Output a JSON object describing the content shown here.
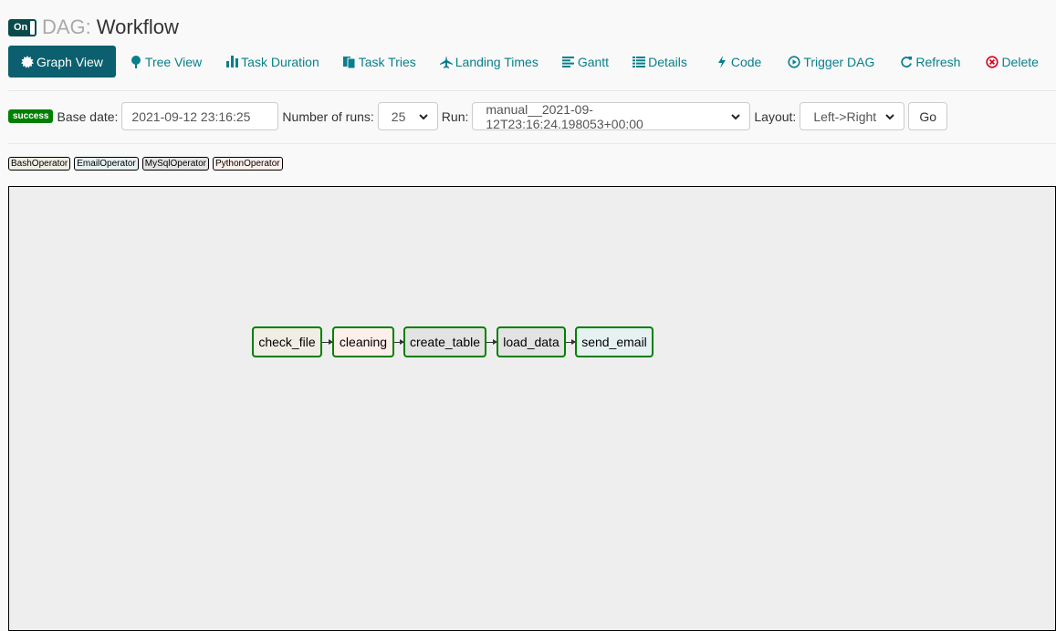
{
  "header": {
    "toggle_label": "On",
    "dag_prefix": "DAG:",
    "dag_name": "Workflow"
  },
  "nav": [
    {
      "label": "Graph View",
      "icon": "certificate-icon",
      "active": true
    },
    {
      "label": "Tree View",
      "icon": "tree-icon"
    },
    {
      "label": "Task Duration",
      "icon": "bar-chart-icon"
    },
    {
      "label": "Task Tries",
      "icon": "files-icon"
    },
    {
      "label": "Landing Times",
      "icon": "plane-icon"
    },
    {
      "label": "Gantt",
      "icon": "align-left-icon"
    },
    {
      "label": "Details",
      "icon": "list-icon"
    },
    {
      "label": "Code",
      "icon": "flash-icon"
    },
    {
      "label": "Trigger DAG",
      "icon": "play-circle-icon"
    },
    {
      "label": "Refresh",
      "icon": "refresh-icon"
    },
    {
      "label": "Delete",
      "icon": "remove-circle-icon"
    }
  ],
  "controls": {
    "state_badge": "success",
    "base_date_label": "Base date:",
    "base_date_value": "2021-09-12 23:16:25",
    "num_runs_label": "Number of runs:",
    "num_runs_value": "25",
    "run_label": "Run:",
    "run_value": "manual__2021-09-12T23:16:24.198053+00:00",
    "layout_label": "Layout:",
    "layout_value": "Left->Right",
    "go_label": "Go"
  },
  "legend": [
    {
      "label": "BashOperator",
      "color": "#f0ede4"
    },
    {
      "label": "EmailOperator",
      "color": "#e6f1f2"
    },
    {
      "label": "MySqlOperator",
      "color": "#e3e3e3"
    },
    {
      "label": "PythonOperator",
      "color": "#ffefeb"
    }
  ],
  "graph": {
    "state_color": "#008000",
    "nodes": [
      {
        "label": "check_file",
        "color": "#f0ede4"
      },
      {
        "label": "cleaning",
        "color": "#ffefeb"
      },
      {
        "label": "create_table",
        "color": "#e3e3e3"
      },
      {
        "label": "load_data",
        "color": "#e3e3e3"
      },
      {
        "label": "send_email",
        "color": "#e6f1f2"
      }
    ]
  },
  "colors": {
    "accent": "#0b5f6e",
    "link": "#087f8c",
    "success": "#008000",
    "danger": "#d9001b"
  }
}
